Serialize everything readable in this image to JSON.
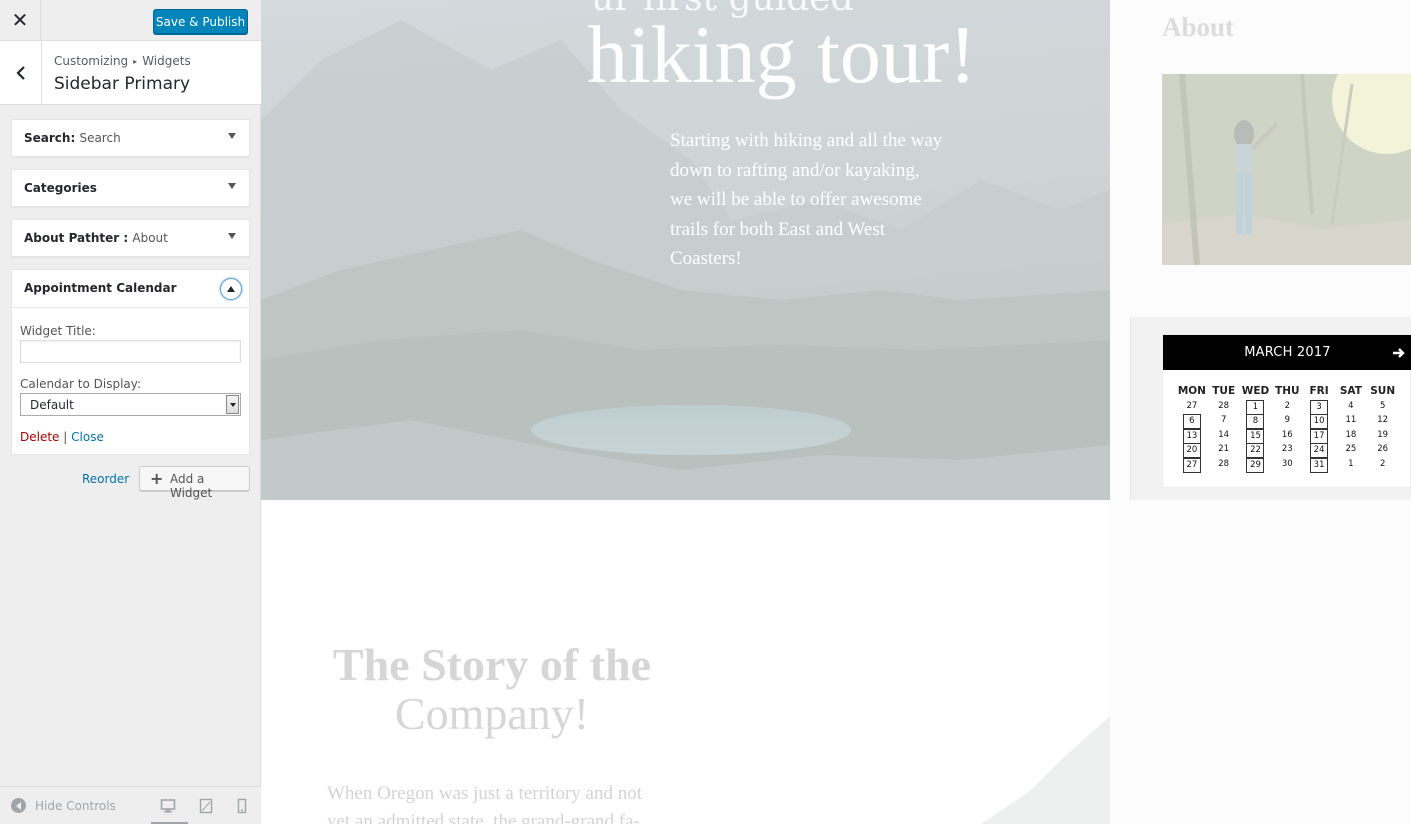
{
  "customizer": {
    "close_symbol": "✕",
    "publish_label": "Save & Publish",
    "breadcrumb": [
      "Customizing",
      "Widgets"
    ],
    "breadcrumb_sep": "▸",
    "section_title": "Sidebar Primary",
    "widgets": [
      {
        "title": "Search:",
        "subtitle": "Search"
      },
      {
        "title": "Categories",
        "subtitle": ""
      },
      {
        "title": "About Pathter :",
        "subtitle": "About"
      }
    ],
    "open_widget": {
      "title": "Appointment Calendar",
      "widget_title_label": "Widget Title:",
      "widget_title_value": "",
      "calendar_label": "Calendar to Display:",
      "calendar_value": "Default",
      "delete_label": "Delete",
      "separator": "|",
      "close_label": "Close"
    },
    "reorder_label": "Reorder",
    "add_widget_plus": "+",
    "add_widget_label": "Add a Widget",
    "hide_controls_label": "Hide Controls"
  },
  "preview": {
    "hero_top_text": "ur first guided",
    "hero_title": "hiking tour!",
    "hero_text": "Starting with hiking and all the way down to rafting and/or kayaking, we will be able to offer awesome trails for both East and West Coasters!",
    "story_title_line1": "The Story of the",
    "story_title_line2": "Company!",
    "story_text": "When Oregon was just a territory and not yet an admitted state, the grand-grand fa-",
    "about_title": "About",
    "calendar": {
      "month": "MARCH 2017",
      "next_symbol": "➔",
      "weekdays": [
        "MON",
        "TUE",
        "WED",
        "THU",
        "FRI",
        "SAT",
        "SUN"
      ],
      "weeks": [
        [
          {
            "d": "27",
            "a": false
          },
          {
            "d": "28",
            "a": false
          },
          {
            "d": "1",
            "a": true
          },
          {
            "d": "2",
            "a": false
          },
          {
            "d": "3",
            "a": true
          },
          {
            "d": "4",
            "a": false
          },
          {
            "d": "5",
            "a": false
          }
        ],
        [
          {
            "d": "6",
            "a": true
          },
          {
            "d": "7",
            "a": false
          },
          {
            "d": "8",
            "a": true
          },
          {
            "d": "9",
            "a": false
          },
          {
            "d": "10",
            "a": true
          },
          {
            "d": "11",
            "a": false
          },
          {
            "d": "12",
            "a": false
          }
        ],
        [
          {
            "d": "13",
            "a": true
          },
          {
            "d": "14",
            "a": false
          },
          {
            "d": "15",
            "a": true
          },
          {
            "d": "16",
            "a": false
          },
          {
            "d": "17",
            "a": true
          },
          {
            "d": "18",
            "a": false
          },
          {
            "d": "19",
            "a": false
          }
        ],
        [
          {
            "d": "20",
            "a": true
          },
          {
            "d": "21",
            "a": false
          },
          {
            "d": "22",
            "a": true
          },
          {
            "d": "23",
            "a": false
          },
          {
            "d": "24",
            "a": true
          },
          {
            "d": "25",
            "a": false
          },
          {
            "d": "26",
            "a": false
          }
        ],
        [
          {
            "d": "27",
            "a": true
          },
          {
            "d": "28",
            "a": false
          },
          {
            "d": "29",
            "a": true
          },
          {
            "d": "30",
            "a": false
          },
          {
            "d": "31",
            "a": true
          },
          {
            "d": "1",
            "a": false
          },
          {
            "d": "2",
            "a": false
          }
        ]
      ]
    }
  },
  "colors": {
    "primary_button": "#0085ba",
    "link": "#0073aa",
    "delete": "#a00",
    "calendar_header": "#000000"
  },
  "icons": [
    "close-icon",
    "back-chevron-icon",
    "expand-arrow-icon",
    "collapse-arrow-icon",
    "dropdown-arrow-icon",
    "plus-icon",
    "hide-controls-icon",
    "desktop-icon",
    "tablet-icon",
    "mobile-icon",
    "calendar-next-arrow-icon"
  ]
}
